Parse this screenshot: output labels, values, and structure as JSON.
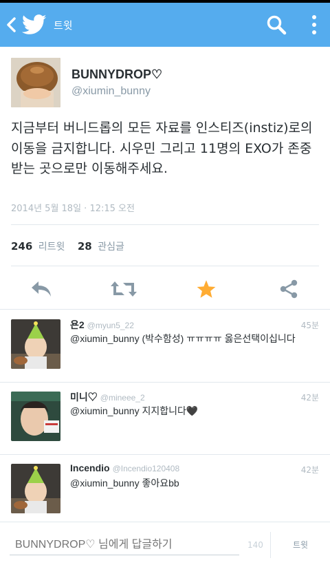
{
  "topbar": {
    "title": "트윗",
    "back_icon": "back-chevron-icon",
    "logo_icon": "twitter-bird-icon",
    "search_icon": "search-icon",
    "more_icon": "overflow-menu-icon",
    "color": "#55acee"
  },
  "tweet": {
    "name": "BUNNYDROP♡",
    "handle": "@xiumin_bunny",
    "text": "지금부터 버니드롭의 모든 자료를 인스티즈(instiz)로의 이동을 금지합니다. 시우민 그리고 11명의 EXO가 존중받는 곳으로만 이동해주세요.",
    "date": "2014년 5월 18일 · 12:15 오전",
    "retweets_count": "246",
    "retweets_label": "리트윗",
    "favorites_count": "28",
    "favorites_label": "관심글"
  },
  "actions": {
    "reply_icon": "reply-icon",
    "retweet_icon": "retweet-icon",
    "favorite_icon": "star-icon",
    "share_icon": "share-icon",
    "favorite_color": "#ffac33"
  },
  "replies": [
    {
      "name": "욘2",
      "handle": "@myun5_22",
      "time": "45분",
      "text": "@xiumin_bunny (박수함성) ㅠㅠㅠㅠ 옳은선택이십니다"
    },
    {
      "name": "미니♡",
      "handle": "@mineee_2",
      "time": "42분",
      "text": "@xiumin_bunny 지지합니다🖤"
    },
    {
      "name": "Incendio",
      "handle": "@Incendio120408",
      "time": "42분",
      "text": "@xiumin_bunny 좋아요bb"
    }
  ],
  "compose": {
    "placeholder": "BUNNYDROP♡ 님에게 답글하기",
    "count": "140",
    "send_label": "트윗"
  }
}
